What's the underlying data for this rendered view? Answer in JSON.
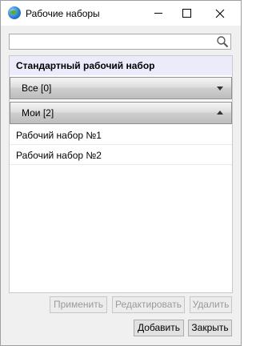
{
  "window": {
    "title": "Рабочие наборы"
  },
  "search": {
    "value": "",
    "placeholder": ""
  },
  "panel": {
    "standard_header": "Стандартный рабочий набор",
    "groups": [
      {
        "label": "Все [0]",
        "state": "collapsed"
      },
      {
        "label": "Мои [2]",
        "state": "expanded"
      }
    ],
    "items": [
      {
        "label": "Рабочий набор №1"
      },
      {
        "label": "Рабочий набор №2"
      }
    ]
  },
  "buttons": {
    "apply": "Применить",
    "edit": "Редактировать",
    "delete": "Удалить",
    "add": "Добавить",
    "close": "Закрыть"
  },
  "icons": {
    "app": "globe-icon",
    "search": "search-icon",
    "collapse": "chevron-down-icon",
    "expand": "chevron-up-icon"
  },
  "colors": {
    "header_bg": "#ecebfb",
    "group_bar": "#cfcfcf",
    "disabled_text": "#9a9a9a"
  }
}
